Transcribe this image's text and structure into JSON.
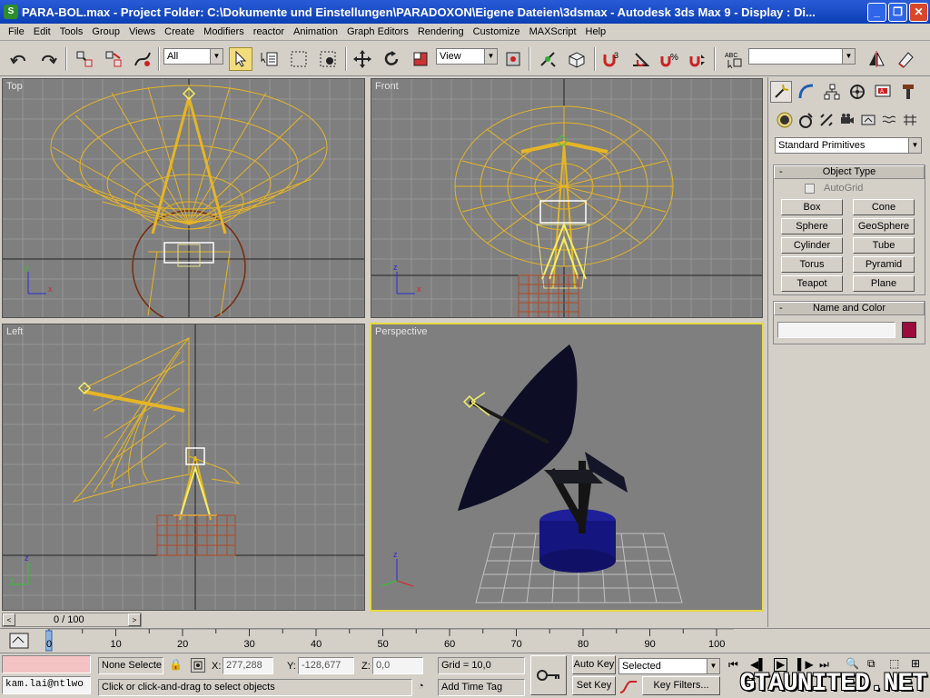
{
  "window": {
    "title": "PARA-BOL.max    - Project Folder: C:\\Dokumente und Einstellungen\\PARADOXON\\Eigene Dateien\\3dsmax    - Autodesk 3ds Max 9    - Display : Di...",
    "app_icon": "3ds-max-icon",
    "minimize": "_",
    "maximize": "❐",
    "close": "✕"
  },
  "menu": [
    "File",
    "Edit",
    "Tools",
    "Group",
    "Views",
    "Create",
    "Modifiers",
    "reactor",
    "Animation",
    "Graph Editors",
    "Rendering",
    "Customize",
    "MAXScript",
    "Help"
  ],
  "toolbar": {
    "selection_filter": "All",
    "reference_coord": "View",
    "named_selection": ""
  },
  "viewports": {
    "top": "Top",
    "front": "Front",
    "left": "Left",
    "perspective": "Perspective"
  },
  "command_panel": {
    "category_dropdown": "Standard Primitives",
    "object_type": {
      "title": "Object Type",
      "collapse": "-",
      "autogrid_label": "AutoGrid",
      "buttons": [
        "Box",
        "Cone",
        "Sphere",
        "GeoSphere",
        "Cylinder",
        "Tube",
        "Torus",
        "Pyramid",
        "Teapot",
        "Plane"
      ]
    },
    "name_color": {
      "title": "Name and Color",
      "collapse": "-",
      "name_value": "",
      "swatch_color": "#9b0b3b"
    }
  },
  "time": {
    "slider_label": "0 / 100",
    "prev": "<",
    "next": ">",
    "ticks": [
      "0",
      "10",
      "20",
      "30",
      "40",
      "50",
      "60",
      "70",
      "80",
      "90",
      "100"
    ]
  },
  "status": {
    "selection": "None Selecte",
    "x_label": "X:",
    "x_value": "277,288",
    "y_label": "Y:",
    "y_value": "-128,677",
    "z_label": "Z:",
    "z_value": "0,0",
    "grid": "Grid = 10,0",
    "prompt": "Click or click-and-drag to select objects",
    "add_time_tag": "Add Time Tag",
    "maxscript_listener": "kam.lai@ntlwo",
    "auto_key": "Auto Key",
    "set_key": "Set Key",
    "key_mode_selected": "Selected",
    "key_filters": "Key Filters...",
    "watermark": "GTAUNITED.NET"
  }
}
